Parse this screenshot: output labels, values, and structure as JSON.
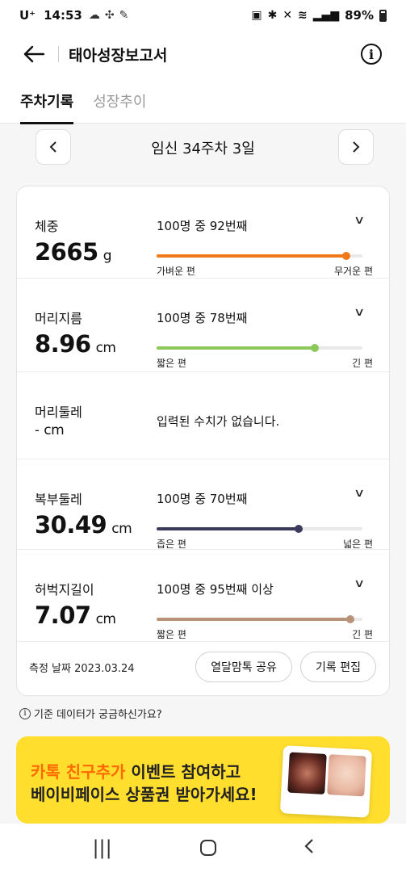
{
  "status": {
    "carrier": "U⁺",
    "time": "14:53",
    "battery": "89%"
  },
  "header": {
    "title": "태아성장보고서"
  },
  "tabs": [
    {
      "label": "주차기록",
      "active": true
    },
    {
      "label": "성장추이",
      "active": false
    }
  ],
  "week": {
    "label": "임신 34주차 3일"
  },
  "measurements": [
    {
      "label": "체중",
      "value": "2665",
      "unit": "g",
      "rank": "100명 중 92번째",
      "low": "가벼운 편",
      "high": "무거운 편",
      "percent": 92,
      "color": "#f07a1a"
    },
    {
      "label": "머리지름",
      "value": "8.96",
      "unit": "cm",
      "rank": "100명 중 78번째",
      "low": "짧은 편",
      "high": "긴 편",
      "percent": 77,
      "color": "#8cc85a"
    },
    {
      "label": "머리둘레",
      "value": "-",
      "unit": "cm",
      "no_data": "입력된 수치가 없습니다."
    },
    {
      "label": "복부둘레",
      "value": "30.49",
      "unit": "cm",
      "rank": "100명 중 70번째",
      "low": "좁은 편",
      "high": "넓은 편",
      "percent": 69,
      "color": "#3b3a5c"
    },
    {
      "label": "허벅지길이",
      "value": "7.07",
      "unit": "cm",
      "rank": "100명 중 95번째 이상",
      "low": "짧은 편",
      "high": "긴 편",
      "percent": 94,
      "color": "#b9927a"
    }
  ],
  "footer": {
    "date": "측정 날짜 2023.03.24",
    "share": "열달맘톡 공유",
    "edit": "기록 편집"
  },
  "help": {
    "text": "기준 데이터가 궁금하신가요?"
  },
  "banner": {
    "accent": "카톡 친구추가",
    "line1_rest": " 이벤트 참여하고",
    "line2": "베이비페이스 상품권 받아가세요!"
  }
}
